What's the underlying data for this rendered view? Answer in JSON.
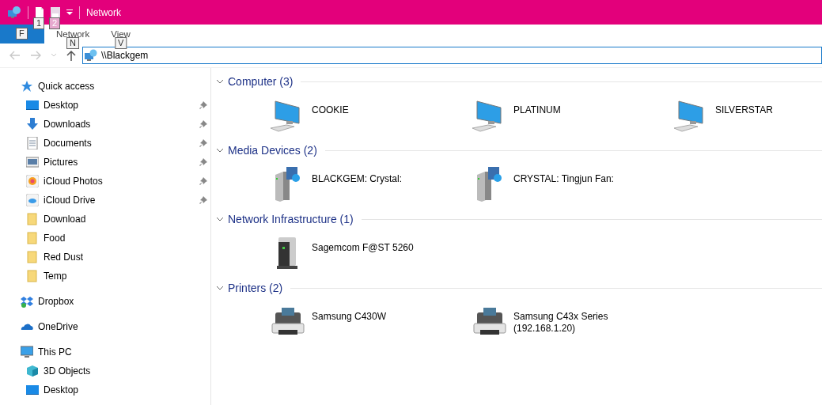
{
  "window": {
    "title": "Network"
  },
  "quick_access_keytips": [
    "1",
    "2"
  ],
  "ribbon": {
    "file_keytip": "F",
    "tabs": [
      {
        "label": "Network",
        "keytip": "N",
        "selected": false
      },
      {
        "label": "View",
        "keytip": "V",
        "selected": false
      }
    ]
  },
  "address_bar": {
    "value": "\\\\Blackgem"
  },
  "sidebar": {
    "items": [
      {
        "label": "Quick access",
        "kind": "star",
        "children": [
          {
            "label": "Desktop",
            "kind": "desktop",
            "pinned": true
          },
          {
            "label": "Downloads",
            "kind": "download",
            "pinned": true
          },
          {
            "label": "Documents",
            "kind": "document",
            "pinned": true
          },
          {
            "label": "Pictures",
            "kind": "pictures",
            "pinned": true
          },
          {
            "label": "iCloud Photos",
            "kind": "photos",
            "pinned": true
          },
          {
            "label": "iCloud Drive",
            "kind": "cloud",
            "pinned": true
          },
          {
            "label": "Download",
            "kind": "folder",
            "pinned": false
          },
          {
            "label": "Food",
            "kind": "folder",
            "pinned": false
          },
          {
            "label": "Red Dust",
            "kind": "folder",
            "pinned": false
          },
          {
            "label": "Temp",
            "kind": "folder",
            "pinned": false
          }
        ]
      },
      {
        "label": "Dropbox",
        "kind": "dropbox"
      },
      {
        "label": "OneDrive",
        "kind": "onedrive"
      },
      {
        "label": "This PC",
        "kind": "pc",
        "children": [
          {
            "label": "3D Objects",
            "kind": "cube",
            "pinned": false
          },
          {
            "label": "Desktop",
            "kind": "desktop",
            "pinned": false
          }
        ]
      }
    ]
  },
  "groups": [
    {
      "title": "Computer (3)",
      "expanded": true,
      "items": [
        {
          "name": "COOKIE",
          "kind": "computer"
        },
        {
          "name": "PLATINUM",
          "kind": "computer"
        },
        {
          "name": "SILVERSTAR",
          "kind": "computer"
        }
      ]
    },
    {
      "title": "Media Devices (2)",
      "expanded": true,
      "items": [
        {
          "name": "BLACKGEM: Crystal:",
          "kind": "media"
        },
        {
          "name": "CRYSTAL: Tingjun Fan:",
          "kind": "media"
        }
      ]
    },
    {
      "title": "Network Infrastructure (1)",
      "expanded": true,
      "items": [
        {
          "name": "Sagemcom F@ST 5260",
          "kind": "router"
        }
      ]
    },
    {
      "title": "Printers (2)",
      "expanded": true,
      "items": [
        {
          "name": "Samsung C430W",
          "kind": "printer"
        },
        {
          "name": "Samsung C43x Series\n(192.168.1.20)",
          "kind": "printer"
        }
      ]
    }
  ]
}
